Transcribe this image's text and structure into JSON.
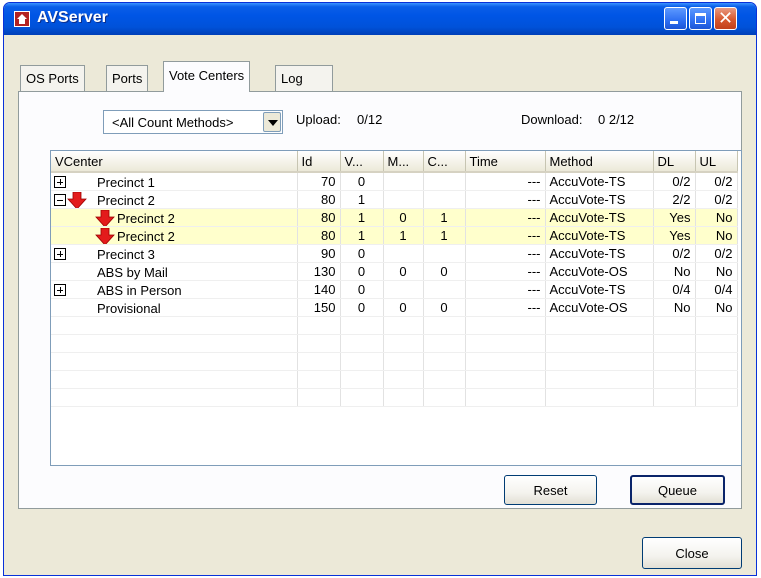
{
  "window": {
    "title": "AVServer"
  },
  "tabs": [
    {
      "label": "OS Ports"
    },
    {
      "label": "Ports"
    },
    {
      "label": "Vote Centers"
    },
    {
      "label": "Log"
    }
  ],
  "filter": {
    "selected": "<All Count Methods>"
  },
  "status": {
    "upload_label": "Upload:",
    "upload_value": "0/12",
    "download_label": "Download:",
    "download_value": "0 2/12"
  },
  "grid": {
    "columns": [
      "VCenter",
      "Id",
      "V...",
      "M...",
      "C...",
      "Time",
      "Method",
      "DL",
      "UL"
    ],
    "rows": [
      {
        "vcenter": "Precinct 1",
        "id": "70",
        "v": "0",
        "m": "",
        "c": "",
        "time": "---",
        "method": "AccuVote-TS",
        "dl": "0/2",
        "ul": "0/2"
      },
      {
        "vcenter": "Precinct 2",
        "id": "80",
        "v": "1",
        "m": "",
        "c": "",
        "time": "---",
        "method": "AccuVote-TS",
        "dl": "2/2",
        "ul": "0/2"
      },
      {
        "vcenter": "Precinct 2",
        "id": "80",
        "v": "1",
        "m": "0",
        "c": "1",
        "time": "---",
        "method": "AccuVote-TS",
        "dl": "Yes",
        "ul": "No"
      },
      {
        "vcenter": "Precinct 2",
        "id": "80",
        "v": "1",
        "m": "1",
        "c": "1",
        "time": "---",
        "method": "AccuVote-TS",
        "dl": "Yes",
        "ul": "No"
      },
      {
        "vcenter": "Precinct 3",
        "id": "90",
        "v": "0",
        "m": "",
        "c": "",
        "time": "---",
        "method": "AccuVote-TS",
        "dl": "0/2",
        "ul": "0/2"
      },
      {
        "vcenter": "ABS by Mail",
        "id": "130",
        "v": "0",
        "m": "0",
        "c": "0",
        "time": "---",
        "method": "AccuVote-OS",
        "dl": "No",
        "ul": "No"
      },
      {
        "vcenter": "ABS in Person",
        "id": "140",
        "v": "0",
        "m": "",
        "c": "",
        "time": "---",
        "method": "AccuVote-TS",
        "dl": "0/4",
        "ul": "0/4"
      },
      {
        "vcenter": "Provisional",
        "id": "150",
        "v": "0",
        "m": "0",
        "c": "0",
        "time": "---",
        "method": "AccuVote-OS",
        "dl": "No",
        "ul": "No"
      }
    ]
  },
  "buttons": {
    "reset": "Reset",
    "queue": "Queue",
    "close": "Close"
  },
  "colors": {
    "titlebar": "#0055e5",
    "highlight_row": "#ffffcc",
    "arrow": "#e31b1b"
  }
}
